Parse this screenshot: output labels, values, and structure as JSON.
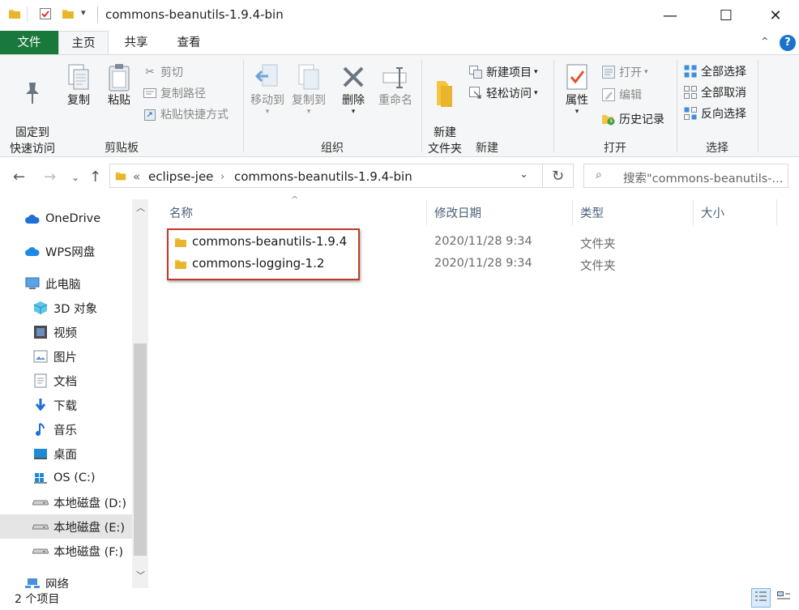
{
  "window": {
    "title": "commons-beanutils-1.9.4-bin",
    "controls": {
      "minimize": "—",
      "maximize": "☐",
      "close": "✕"
    }
  },
  "tabs": [
    {
      "label": "文件"
    },
    {
      "label": "主页"
    },
    {
      "label": "共享"
    },
    {
      "label": "查看"
    }
  ],
  "ribbon": {
    "clipboard": {
      "label": "剪贴板",
      "pin": "固定到\n快速访问",
      "copy": "复制",
      "paste": "粘贴",
      "cut": "剪切",
      "copy_path": "复制路径",
      "paste_shortcut": "粘贴快捷方式"
    },
    "organize": {
      "label": "组织",
      "move_to": "移动到",
      "copy_to": "复制到",
      "delete": "删除",
      "rename": "重命名"
    },
    "new": {
      "label": "新建",
      "new_folder": "新建\n文件夹",
      "new_item": "新建项目",
      "easy_access": "轻松访问"
    },
    "open": {
      "label": "打开",
      "properties": "属性",
      "open": "打开",
      "edit": "编辑",
      "history": "历史记录"
    },
    "select": {
      "label": "选择",
      "select_all": "全部选择",
      "select_none": "全部取消",
      "invert": "反向选择"
    }
  },
  "address": {
    "prefix": "«",
    "crumbs": [
      "eclipse-jee",
      "commons-beanutils-1.9.4-bin"
    ],
    "search_placeholder": "搜索\"commons-beanutils-..."
  },
  "nav": [
    {
      "label": "OneDrive",
      "icon": "cloud-icon"
    },
    {
      "label": "WPS网盘",
      "icon": "cloud-icon"
    },
    {
      "label": "此电脑",
      "icon": "computer-icon"
    },
    {
      "label": "3D 对象",
      "icon": "cube-icon"
    },
    {
      "label": "视频",
      "icon": "video-icon"
    },
    {
      "label": "图片",
      "icon": "picture-icon"
    },
    {
      "label": "文档",
      "icon": "document-icon"
    },
    {
      "label": "下载",
      "icon": "download-icon"
    },
    {
      "label": "音乐",
      "icon": "music-icon"
    },
    {
      "label": "桌面",
      "icon": "desktop-icon"
    },
    {
      "label": "OS (C:)",
      "icon": "windows-drive-icon"
    },
    {
      "label": "本地磁盘 (D:)",
      "icon": "drive-icon"
    },
    {
      "label": "本地磁盘 (E:)",
      "icon": "drive-icon"
    },
    {
      "label": "本地磁盘 (F:)",
      "icon": "drive-icon"
    },
    {
      "label": "网络",
      "icon": "network-icon"
    }
  ],
  "columns": {
    "name": "名称",
    "date": "修改日期",
    "type": "类型",
    "size": "大小"
  },
  "files": [
    {
      "name": "commons-beanutils-1.9.4",
      "date": "2020/11/28 9:34",
      "type": "文件夹"
    },
    {
      "name": "commons-logging-1.2",
      "date": "2020/11/28 9:34",
      "type": "文件夹"
    }
  ],
  "status": {
    "count": "2 个项目"
  },
  "colors": {
    "file_tab": "#19783b",
    "highlight_border": "#c0392b",
    "folder": "#f4c542"
  }
}
